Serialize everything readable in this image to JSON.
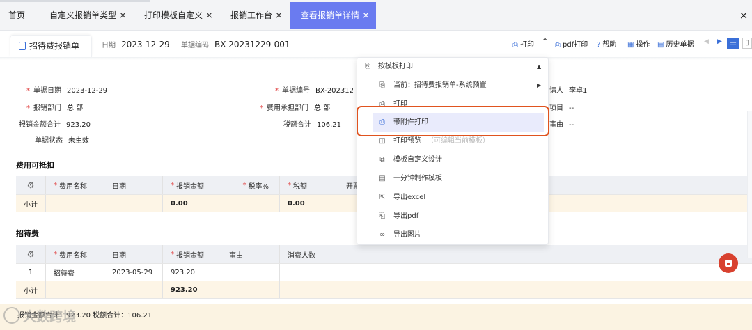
{
  "tabs": [
    {
      "label": "首页",
      "closable": false
    },
    {
      "label": "自定义报销单类型",
      "closable": true
    },
    {
      "label": "打印模板自定义",
      "closable": true
    },
    {
      "label": "报销工作台",
      "closable": true
    },
    {
      "label": "查看报销单详情",
      "closable": true,
      "active": true
    }
  ],
  "tab_close_all": "×",
  "close_glyph": "×",
  "header": {
    "doc_tab": "招待费报销单",
    "date_label": "日期",
    "date_value": "2023-12-29",
    "code_label": "单据编码",
    "code_value": "BX-20231229-001"
  },
  "toolbar": {
    "print": "打印",
    "pdf_print": "pdf打印",
    "help": "帮助",
    "ops": "操作",
    "history": "历史单据"
  },
  "form": {
    "doc_date_label": "单据日期",
    "doc_date": "2023-12-29",
    "doc_no_label": "单据编号",
    "doc_no": "BX-202312",
    "applicant_label": "请人",
    "applicant": "李卓1",
    "dept_label": "报销部门",
    "dept": "总 部",
    "cost_dept_label": "费用承担部门",
    "cost_dept": "总 部",
    "project_label": "项目",
    "project": "--",
    "amount_label": "报销金额合计",
    "amount": "923.20",
    "tax_label": "税额合计",
    "tax": "106.21",
    "reason_label": "事由",
    "reason": "--",
    "status_label": "单据状态",
    "status": "未生效"
  },
  "section1": {
    "title": "费用可抵扣",
    "headers": [
      "费用名称",
      "日期",
      "报销金额",
      "税率%",
      "税额",
      "开票"
    ],
    "subtotal_label": "小计",
    "subtotal_amount": "0.00",
    "subtotal_tax": "0.00"
  },
  "section2": {
    "title": "招待费",
    "headers": [
      "费用名称",
      "日期",
      "报销金额",
      "事由",
      "消费人数"
    ],
    "rows": [
      {
        "no": "1",
        "name": "招待费",
        "date": "2023-05-29",
        "amount": "923.20",
        "reason": "",
        "people": ""
      }
    ],
    "subtotal_label": "小计",
    "subtotal_amount": "923.20"
  },
  "footer": {
    "text": "报销金额合计：923.20  税额合计：106.21"
  },
  "watermark": "大数跨境",
  "print_menu": {
    "header": "按模板打印",
    "current": "当前：招待费报销单-系统预置",
    "items": [
      {
        "label": "打印",
        "hint": ""
      },
      {
        "label": "带附件打印",
        "hint": "",
        "highlighted": true
      },
      {
        "label": "打印预览",
        "hint": "（可编辑当前模板）"
      },
      {
        "label": "模板自定义设计",
        "hint": ""
      },
      {
        "label": "一分钟制作模板",
        "hint": ""
      },
      {
        "label": "导出excel",
        "hint": ""
      },
      {
        "label": "导出pdf",
        "hint": ""
      },
      {
        "label": "导出图片",
        "hint": ""
      }
    ]
  },
  "colors": {
    "accent": "#6a7bf0",
    "primary": "#3a6fd8",
    "required": "#e03c3c",
    "highlight_border": "#e0531f",
    "subtotal_bg": "#fdf5e6"
  }
}
